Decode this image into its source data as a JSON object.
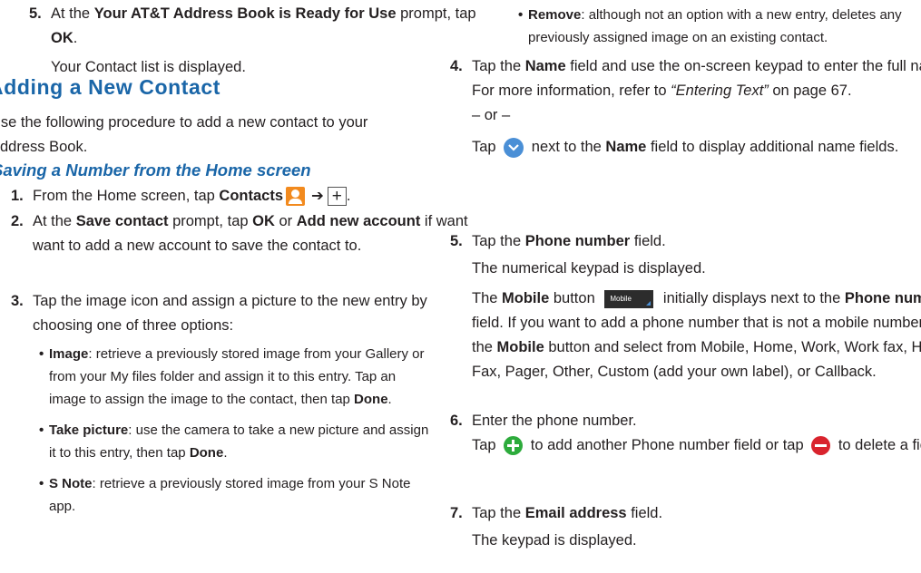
{
  "left": {
    "step5": {
      "num": "5.",
      "pre": "At the ",
      "bold1": "Your AT&T Address Book is Ready for Use",
      "mid": " prompt, tap ",
      "bold2": "OK",
      "end": ".",
      "result": "Your Contact list is displayed."
    },
    "section_title": "Adding a New Contact",
    "intro": "Use the following procedure to add a new contact to your Address Book.",
    "subsection_title": "Saving a Number from the Home screen",
    "steps": [
      {
        "num": "1.",
        "pre": "From the Home screen, tap ",
        "bold": "Contacts",
        "arrow": "➔",
        "plus": "+"
      },
      {
        "num": "2.",
        "pre": "At the ",
        "bold1": "Save contact",
        "mid1": " prompt, tap ",
        "bold2": "OK",
        "mid2": " or ",
        "bold3": "Add new account",
        "end": " if want want to add a new account to save the contact to."
      },
      {
        "num": "3.",
        "text": "Tap the image icon and assign a picture to the new entry by choosing one of three options:"
      }
    ],
    "bullets": [
      {
        "dot": "•",
        "bold": "Image",
        "text1": ": retrieve a previously stored image from your Gallery or from your My files folder and assign it to this entry. Tap an image to assign the image to the contact, then tap ",
        "bold2": "Done",
        "end": "."
      },
      {
        "dot": "•",
        "bold": "Take picture",
        "text1": ": use the camera to take a new picture and assign it to this entry, then tap ",
        "bold2": "Done",
        "end": "."
      },
      {
        "dot": "•",
        "bold": "S Note",
        "text1": ": retrieve a previously stored image from your S Note app."
      }
    ]
  },
  "right": {
    "remove_bullet": {
      "dot": "•",
      "bold": "Remove",
      "text": ": although not an option with a new entry, deletes any previously assigned image on an existing contact."
    },
    "step4": {
      "num": "4.",
      "pre": "Tap the ",
      "bold": "Name",
      "mid": " field and use the on-screen keypad to enter the full name. For more information, refer to ",
      "ref": "“Entering Text”",
      "end": "  on page 67.",
      "or": "– or –",
      "alt_pre": "Tap ",
      "alt_mid": " next to the ",
      "alt_bold": "Name",
      "alt_end": " field to display additional name fields."
    },
    "step5": {
      "num": "5.",
      "pre": "Tap the ",
      "bold": "Phone number",
      "end": " field.",
      "result": "The numerical keypad is displayed.",
      "p_pre": "The ",
      "p_bold1": "Mobile",
      "p_mid1": " button ",
      "mobile_label": "Mobile",
      "p_mid2": " initially displays next to the ",
      "p_bold2": "Phone number",
      "p_mid3": " field. If you want to add a phone number that is not a mobile number, tap the ",
      "p_bold3": "Mobile",
      "p_end": " button and select from Mobile, Home, Work, Work fax, Home Fax, Pager, Other, Custom (add your own label), or Callback."
    },
    "step6": {
      "num": "6.",
      "text": "Enter the phone number.",
      "tap": "Tap ",
      "mid": " to add another Phone number field or tap ",
      "end": " to delete a field."
    },
    "step7": {
      "num": "7.",
      "pre": "Tap the ",
      "bold": "Email address",
      "end": " field.",
      "result": "The keypad is displayed."
    }
  }
}
